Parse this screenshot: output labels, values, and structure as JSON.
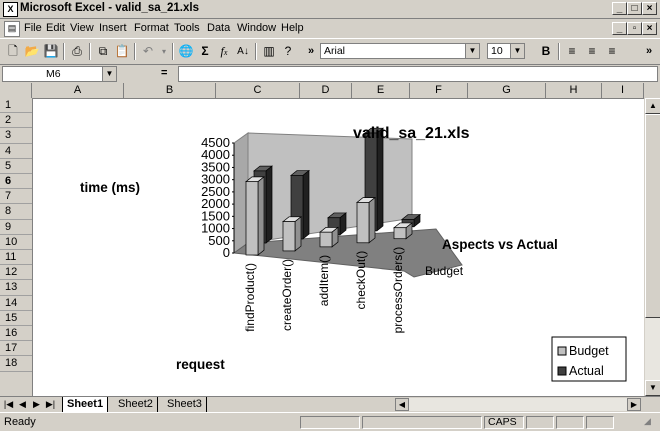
{
  "window": {
    "title": "Microsoft Excel - valid_sa_21.xls",
    "icon": "excel-icon"
  },
  "menu": [
    "File",
    "Edit",
    "View",
    "Insert",
    "Format",
    "Tools",
    "Data",
    "Window",
    "Help"
  ],
  "toolbar": {
    "font": "Arial",
    "size": "10",
    "bold": "B",
    "overflow": "»"
  },
  "formula_bar": {
    "cell_ref": "M6",
    "equals": "="
  },
  "columns": [
    "A",
    "B",
    "C",
    "D",
    "E",
    "F",
    "G",
    "H",
    "I"
  ],
  "rows": [
    "1",
    "2",
    "3",
    "4",
    "5",
    "6",
    "7",
    "8",
    "9",
    "10",
    "11",
    "12",
    "13",
    "14",
    "15",
    "16",
    "17",
    "18"
  ],
  "cells": {
    "time_label": "time (ms)",
    "request_label": "request"
  },
  "sheets": {
    "active": "Sheet1",
    "others": [
      "Sheet2",
      "Sheet3"
    ]
  },
  "status": {
    "mode": "Ready",
    "caps": "CAPS"
  },
  "chart_data": {
    "type": "bar",
    "title": "valid_sa_21.xls",
    "xlabel": "request",
    "ylabel": "time (ms)",
    "depth_axis_label": "Aspects vs Actual",
    "categories": [
      "findProduct()",
      "createOrder()",
      "addItem()",
      "checkOut()",
      "processOrders()"
    ],
    "series": [
      {
        "name": "Budget",
        "values": [
          3000,
          1200,
          600,
          1650,
          450
        ],
        "color": "#c0c0c0"
      },
      {
        "name": "Actual",
        "values": [
          2950,
          2600,
          700,
          4000,
          300
        ],
        "color": "#404040"
      }
    ],
    "yticks": [
      "0",
      "500",
      "1000",
      "1500",
      "2000",
      "2500",
      "3000",
      "3500",
      "4000",
      "4500"
    ],
    "ylim": [
      0,
      4500
    ],
    "depth_labels": [
      "Budget"
    ],
    "legend": {
      "placement": "bottom-right",
      "items": [
        "Budget",
        "Actual"
      ]
    },
    "grid": false
  }
}
